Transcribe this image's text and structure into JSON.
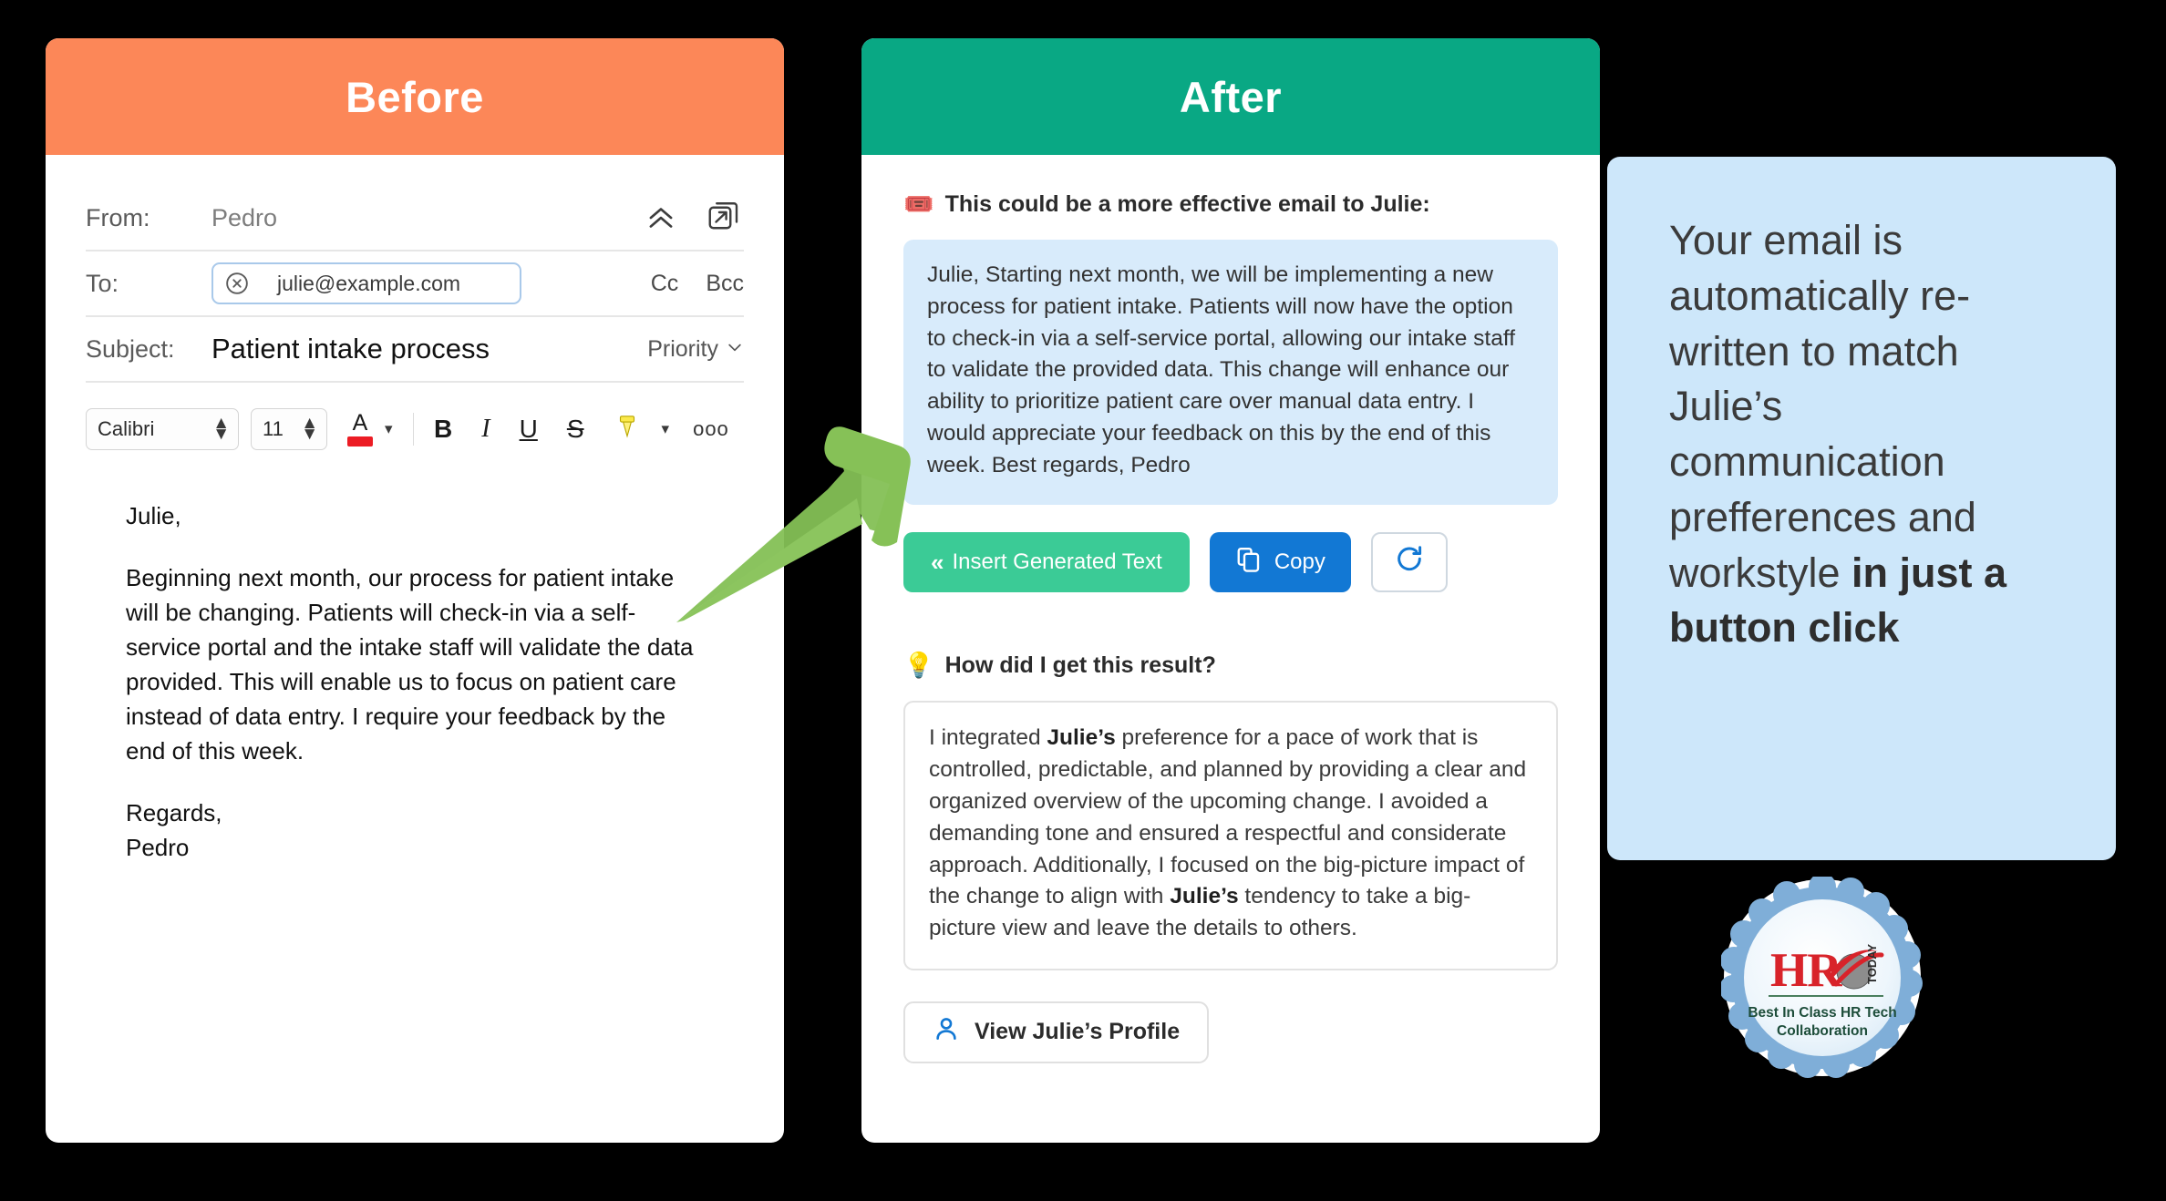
{
  "before": {
    "header_title": "Before",
    "header_color": "#FC8758",
    "fields": {
      "from_label": "From:",
      "from_value": "Pedro",
      "to_label": "To:",
      "to_chip": "julie@example.com",
      "cc_label": "Cc",
      "bcc_label": "Bcc",
      "subject_label": "Subject:",
      "subject_value": "Patient intake process",
      "priority_label": "Priority"
    },
    "toolbar": {
      "font_family": "Calibri",
      "font_size": "11",
      "font_color_letter": "A",
      "font_color_swatch": "#ec1c24",
      "bold": "B",
      "italic": "I",
      "underline": "U",
      "strikethrough": "S",
      "more_label": "ooo"
    },
    "body": {
      "greeting": "Julie,",
      "paragraph": "Beginning next month, our process for patient intake will be changing. Patients will check-in via a self-service portal and the intake staff will validate the data provided. This will enable us to focus on patient care instead of data entry. I require your feedback by the end of this week.",
      "signoff": "Regards,",
      "signature": "Pedro"
    }
  },
  "after": {
    "header_title": "After",
    "header_color": "#09A884",
    "section1_title": "This could be a more effective email to Julie:",
    "generated_text": "Julie, Starting next month, we will be implementing a new process for patient intake. Patients will now have the option to check-in via a self-service portal, allowing our intake staff to validate the provided data. This change will enhance our ability to prioritize patient care over manual data entry. I would appreciate your feedback on this by the end of this week. Best regards, Pedro",
    "buttons": {
      "insert_label": "Insert Generated Text",
      "copy_label": "Copy",
      "refresh_label": ""
    },
    "section2_title": "How did I get this result?",
    "explanation": {
      "part1": "I integrated ",
      "bold1": "Julie’s",
      "part2": " preference for a pace of work that is controlled, predictable, and planned by providing a clear and organized overview of the upcoming change. I avoided a demanding tone and ensured a respectful and considerate approach. Additionally, I focused on the big-picture impact of the change to align with ",
      "bold2": "Julie’s",
      "part3": " tendency to take a big-picture view and leave the details to others."
    },
    "profile_button_label": "View Julie’s Profile"
  },
  "callout": {
    "text_normal": "Your email is automatically re-written to match Julie’s communication prefferences and workstyle ",
    "text_bold": "in just a button click",
    "background_color": "#CDE7FA"
  },
  "badge": {
    "brand": "HR",
    "brand_suffix": "TODAY",
    "line1": "Best In Class HR Tech",
    "line2": "Collaboration"
  },
  "arrow": {
    "color": "#7DBF55"
  }
}
